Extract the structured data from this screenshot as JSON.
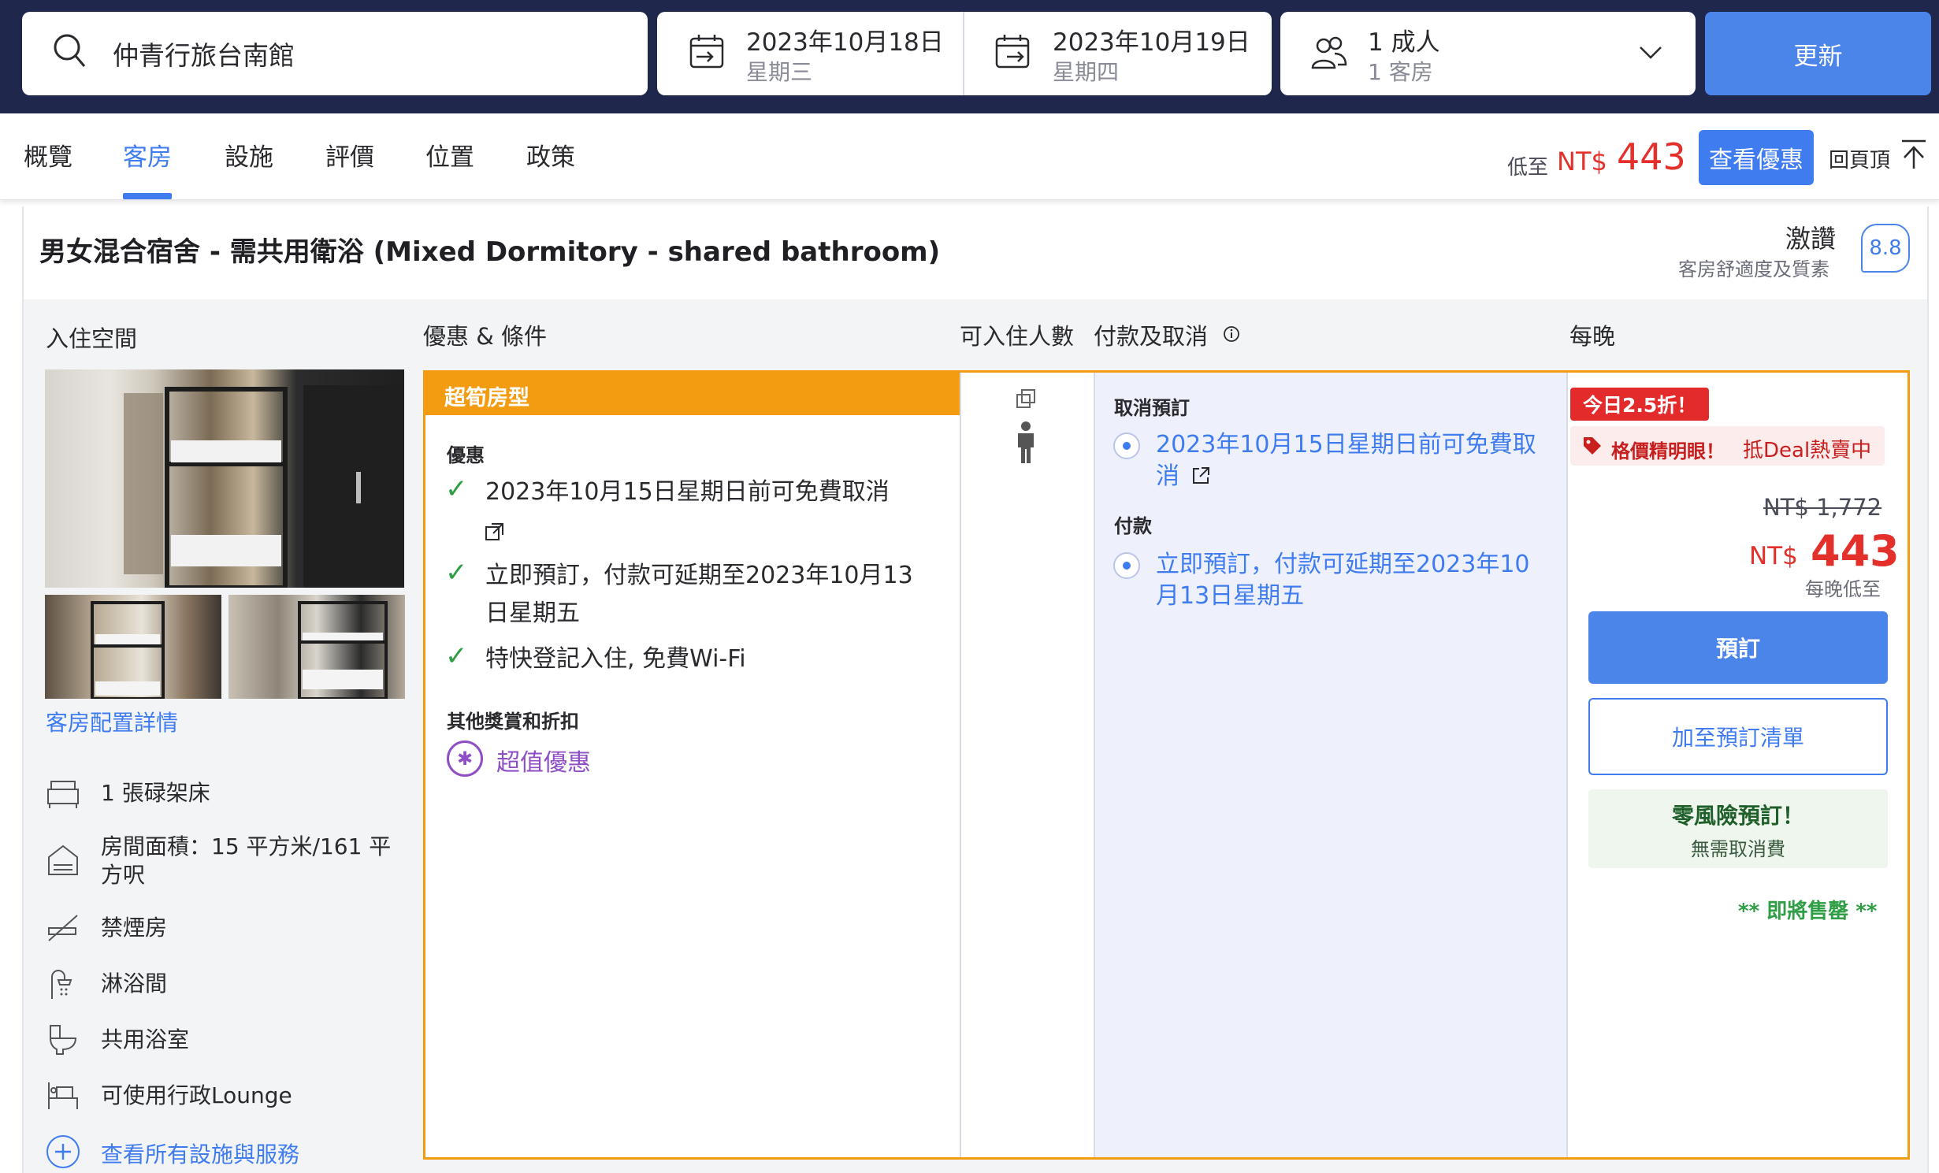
{
  "search": {
    "hotel": "仲青行旅台南館",
    "checkin_date": "2023年10月18日",
    "checkin_day": "星期三",
    "checkout_date": "2023年10月19日",
    "checkout_day": "星期四",
    "guests": "1 成人",
    "rooms": "1 客房",
    "update_label": "更新"
  },
  "nav": {
    "tabs": [
      {
        "label": "概覽"
      },
      {
        "label": "客房",
        "active": true
      },
      {
        "label": "設施"
      },
      {
        "label": "評價"
      },
      {
        "label": "位置"
      },
      {
        "label": "政策"
      }
    ],
    "low_label": "低至",
    "low_currency": "NT$",
    "low_price": "443",
    "view_deal": "查看優惠",
    "back_to_top": "回頁頂"
  },
  "room": {
    "title": "男女混合宿舍 - 需共用衛浴 (Mixed Dormitory - shared bathroom)",
    "rating_word": "激讚",
    "rating_sub": "客房舒適度及質素",
    "rating_score": "8.8",
    "room_detail_link": "客房配置詳情",
    "amenities": [
      {
        "icon": "bed-icon",
        "label": "1 張碌架床"
      },
      {
        "icon": "house-icon",
        "label": "房間面積：15 平方米/161 平方呎"
      },
      {
        "icon": "no-smoking-icon",
        "label": "禁煙房"
      },
      {
        "icon": "shower-icon",
        "label": "淋浴間"
      },
      {
        "icon": "toilet-icon",
        "label": "共用浴室"
      },
      {
        "icon": "lounge-icon",
        "label": "可使用行政Lounge"
      }
    ],
    "see_all_label": "查看所有設施與服務"
  },
  "table": {
    "headers": {
      "space": "入住空間",
      "deals": "優惠 & 條件",
      "capacity": "可入住人數",
      "payment": "付款及取消",
      "nightly": "每晚"
    },
    "deal_type": "超筍房型",
    "benefits_label": "優惠",
    "conditions": [
      "2023年10月15日星期日前可免費取消",
      "立即預訂，付款可延期至2023年10月13日星期五",
      "特快登記入住, 免費Wi-Fi"
    ],
    "other_rewards_label": "其他獎賞和折扣",
    "promo_label": "超值優惠",
    "cancel_label": "取消預訂",
    "cancel_text": "2023年10月15日星期日前可免費取消",
    "payment_label": "付款",
    "payment_text": "立即預訂，付款可延期至2023年10月13日星期五"
  },
  "price": {
    "today_badge": "今日2.5折！",
    "tag_strong": "格價精明眼！",
    "tag_rest": "抵Deal熱賣中",
    "old_price": "NT$ 1,772",
    "currency": "NT$",
    "new_price": "443",
    "per_night": "每晚低至",
    "book_label": "預訂",
    "add_list_label": "加至預訂清單",
    "zero_risk_title": "零風險預訂！",
    "zero_risk_sub": "無需取消費",
    "selling_fast": "** 即將售罄 **"
  },
  "colors": {
    "brand_blue": "#3f7cf0",
    "header_navy": "#20274d",
    "deal_orange": "#f39c12",
    "price_red": "#e4302b",
    "check_green": "#2f9e44"
  }
}
